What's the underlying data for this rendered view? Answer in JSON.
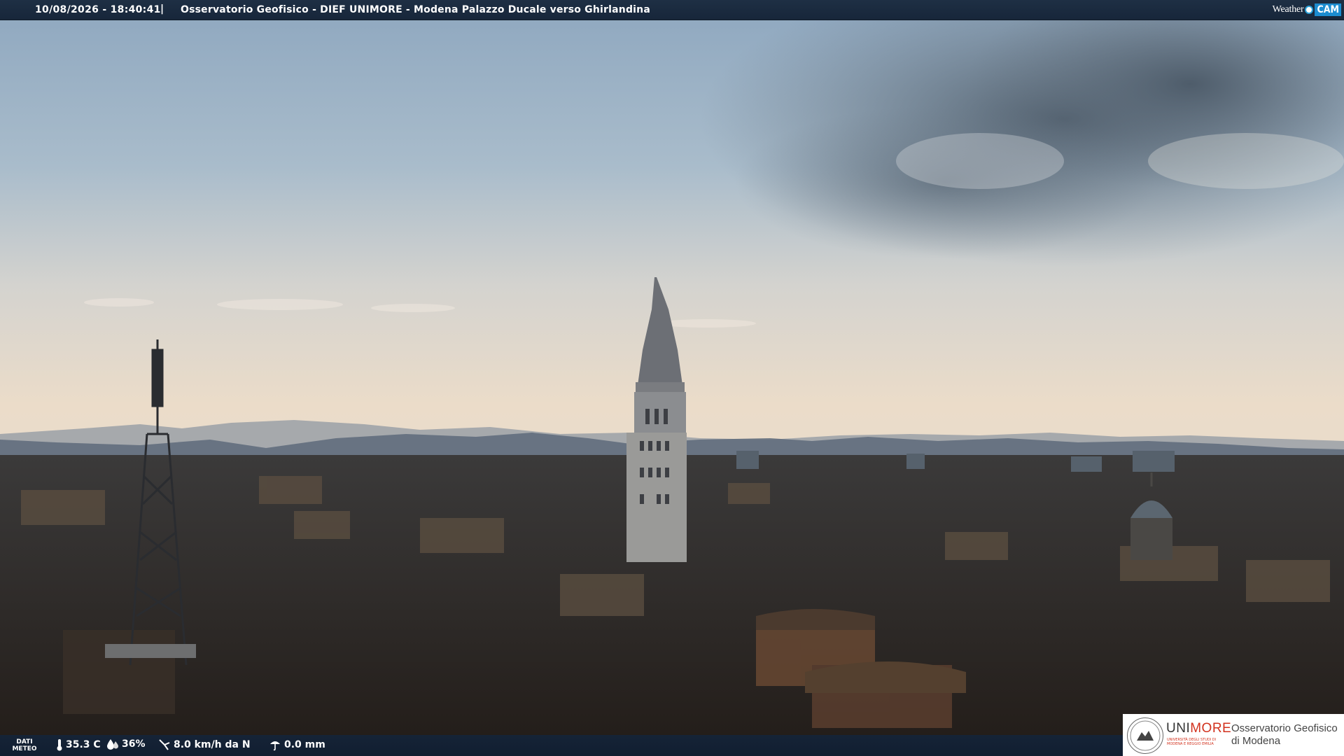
{
  "header": {
    "timestamp": "10/08/2026 - 18:40:41",
    "separator": "|",
    "caption": "Osservatorio Geofisico - DIEF UNIMORE - Modena Palazzo Ducale verso Ghirlandina",
    "brand_weather": "Weather",
    "brand_cam": "CAM"
  },
  "weather": {
    "title": "DATI METEO",
    "temperature": "35.3 C",
    "temperature_icon": "thermometer-icon",
    "humidity": "36%",
    "humidity_icon": "drop-icon",
    "wind": "8.0 km/h da N",
    "wind_icon": "wind-icon",
    "rain": "0.0 mm",
    "rain_icon": "umbrella-icon"
  },
  "logo": {
    "uni_part1": "UNI",
    "uni_part2": "MORE",
    "uni_subtitle": "UNIVERSITÀ DEGLI STUDI DI MODENA E REGGIO EMILIA",
    "observatory_line1": "Osservatorio Geofisico",
    "observatory_line2": "di Modena"
  },
  "colors": {
    "bar": "#17263a",
    "brand_blue": "#1c8cd0",
    "unimore_red": "#d2321e"
  }
}
